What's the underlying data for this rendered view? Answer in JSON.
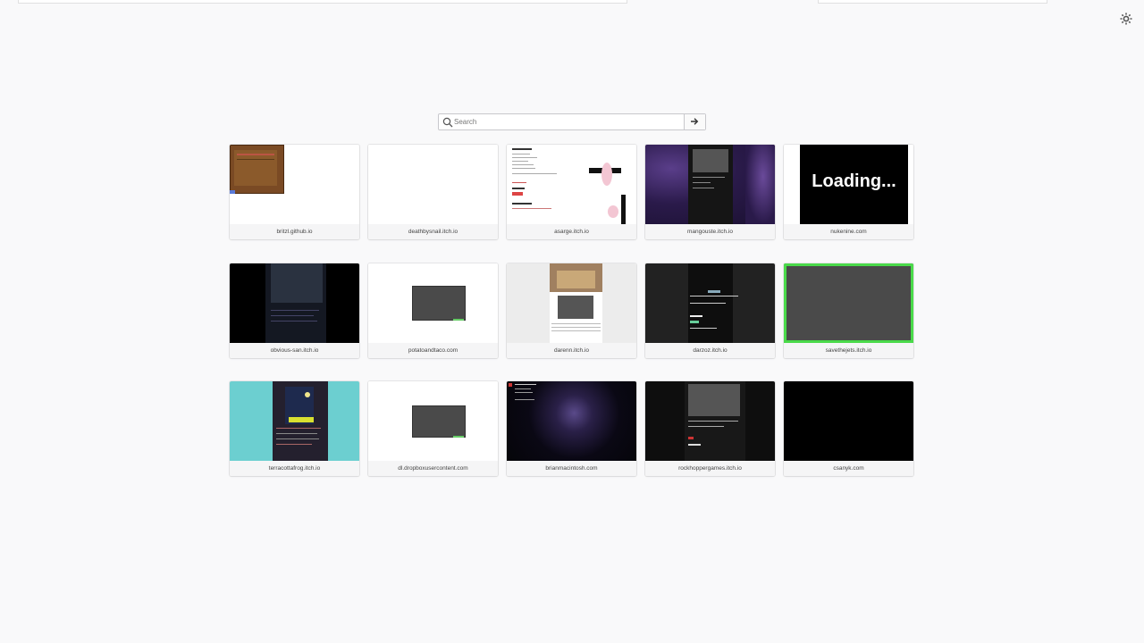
{
  "search": {
    "placeholder": "Search"
  },
  "icons": {
    "settings": "gear-icon",
    "search": "search-icon",
    "go": "arrow-right-icon"
  },
  "thumbnail_texts": {
    "loading": "Loading..."
  },
  "tiles": [
    {
      "label": "britzl.github.io"
    },
    {
      "label": "deathbysnail.itch.io"
    },
    {
      "label": "asarge.itch.io"
    },
    {
      "label": "mangouste.itch.io"
    },
    {
      "label": "nukenine.com"
    },
    {
      "label": "obvious-san.itch.io"
    },
    {
      "label": "potatoandtaco.com"
    },
    {
      "label": "darenn.itch.io"
    },
    {
      "label": "darzoz.itch.io"
    },
    {
      "label": "savethejets.itch.io"
    },
    {
      "label": "terracottafrog.itch.io"
    },
    {
      "label": "dl.dropboxusercontent.com"
    },
    {
      "label": "brianmacintosh.com"
    },
    {
      "label": "rockhoppergames.itch.io"
    },
    {
      "label": "csanyk.com"
    }
  ]
}
